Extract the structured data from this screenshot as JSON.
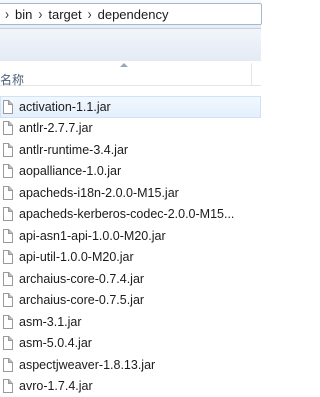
{
  "breadcrumb": {
    "items": [
      "bin",
      "target",
      "dependency"
    ]
  },
  "column_header": {
    "name_label": "名称"
  },
  "files": [
    "activation-1.1.jar",
    "antlr-2.7.7.jar",
    "antlr-runtime-3.4.jar",
    "aopalliance-1.0.jar",
    "apacheds-i18n-2.0.0-M15.jar",
    "apacheds-kerberos-codec-2.0.0-M15...",
    "api-asn1-api-1.0.0-M20.jar",
    "api-util-1.0.0-M20.jar",
    "archaius-core-0.7.4.jar",
    "archaius-core-0.7.5.jar",
    "asm-3.1.jar",
    "asm-5.0.4.jar",
    "aspectjweaver-1.8.13.jar",
    "avro-1.7.4.jar"
  ],
  "hovered_index": 0,
  "icons": {
    "separator": "chevron-right-icon",
    "file": "file-icon",
    "sort": "sort-caret-icon"
  }
}
